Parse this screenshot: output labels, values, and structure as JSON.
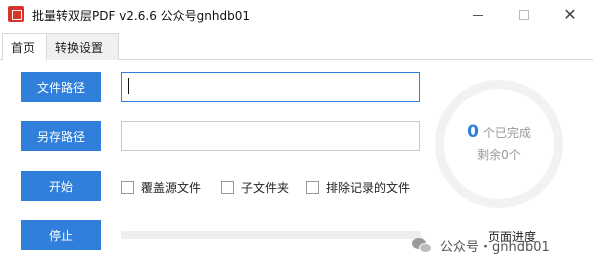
{
  "window": {
    "title": "批量转双层PDF v2.6.6 公众号gnhdb01",
    "minimize": "minimize",
    "maximize": "maximize",
    "close": "✕"
  },
  "tabs": [
    {
      "label": "首页",
      "active": true
    },
    {
      "label": "转换设置",
      "active": false
    }
  ],
  "buttons": {
    "file_path": "文件路径",
    "save_path": "另存路径",
    "start": "开始",
    "stop": "停止"
  },
  "inputs": {
    "file_path_value": "",
    "save_path_value": ""
  },
  "options": [
    {
      "label": "覆盖源文件",
      "checked": false
    },
    {
      "label": "子文件夹",
      "checked": false
    },
    {
      "label": "排除记录的文件",
      "checked": false
    }
  ],
  "progress": {
    "page_progress_label": "页面进度",
    "value": 0
  },
  "stats": {
    "completed_count": "0",
    "completed_label": "个已完成",
    "remaining_label": "剩余0个"
  },
  "watermark": {
    "text": "公众号・gnhdb01"
  },
  "colors": {
    "accent": "#2f7fdb",
    "close_icon": "#444444"
  }
}
